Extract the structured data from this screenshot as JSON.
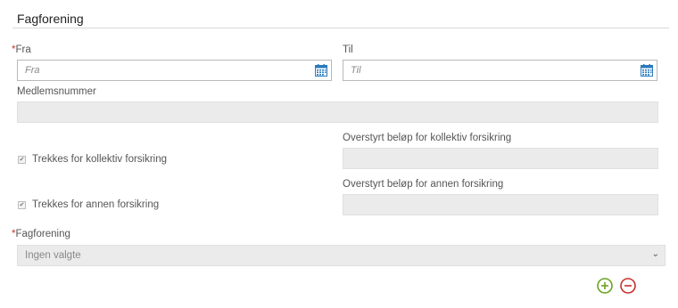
{
  "section": {
    "title": "Fagforening"
  },
  "from": {
    "required_mark": "*",
    "label": "Fra",
    "placeholder": "Fra"
  },
  "to": {
    "label": "Til",
    "placeholder": "Til"
  },
  "member": {
    "label": "Medlemsnummer",
    "value": ""
  },
  "collective": {
    "checkbox_label": "Trekkes for kollektiv forsikring",
    "checked": true,
    "override_label": "Overstyrt beløp for kollektiv forsikring",
    "override_value": ""
  },
  "other": {
    "checkbox_label": "Trekkes for annen forsikring",
    "checked": true,
    "override_label": "Overstyrt beløp for annen forsikring",
    "override_value": ""
  },
  "union": {
    "required_mark": "*",
    "label": "Fagforening",
    "selected": "Ingen valgte"
  },
  "colors": {
    "add": "#6aa321",
    "remove": "#c9302c",
    "calendar": "#2b7bbf",
    "required": "#c0392b"
  },
  "icons": {
    "calendar": "calendar-icon",
    "add": "plus-circle-icon",
    "remove": "minus-circle-icon",
    "chevron": "chevron-down-icon"
  }
}
